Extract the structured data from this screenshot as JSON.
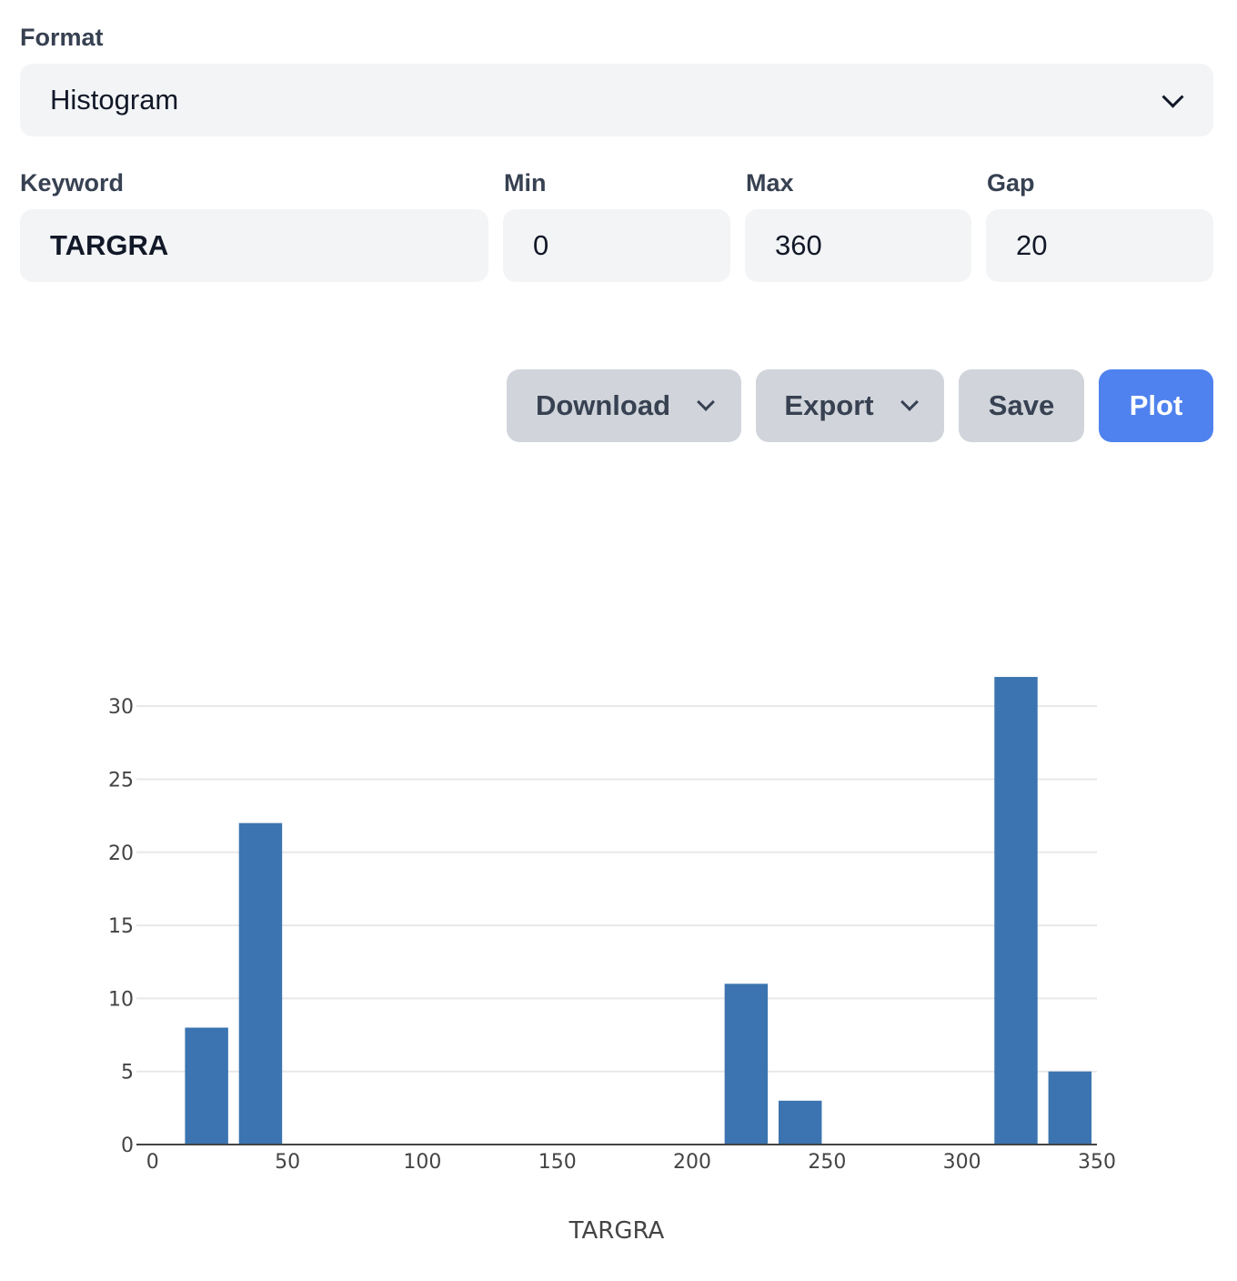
{
  "form": {
    "format_label": "Format",
    "format_value": "Histogram",
    "keyword_label": "Keyword",
    "keyword_value": "TARGRA",
    "min_label": "Min",
    "min_value": "0",
    "max_label": "Max",
    "max_value": "360",
    "gap_label": "Gap",
    "gap_value": "20"
  },
  "toolbar": {
    "download_label": "Download",
    "export_label": "Export",
    "save_label": "Save",
    "plot_label": "Plot"
  },
  "colors": {
    "accent": "#4f82ee",
    "bar": "#3b74b0"
  },
  "icons": {
    "dropdown": "chevron-down-icon"
  },
  "chart_data": {
    "type": "bar",
    "xlabel": "TARGRA",
    "ylabel": "",
    "xlim": [
      -6,
      350
    ],
    "ylim": [
      0,
      33
    ],
    "x_ticks": [
      0,
      50,
      100,
      150,
      200,
      250,
      300,
      350
    ],
    "y_ticks": [
      0,
      5,
      10,
      15,
      20,
      25,
      30
    ],
    "bins": [
      {
        "start": 12,
        "end": 28,
        "value": 8
      },
      {
        "start": 32,
        "end": 48,
        "value": 22
      },
      {
        "start": 212,
        "end": 228,
        "value": 11
      },
      {
        "start": 232,
        "end": 248,
        "value": 3
      },
      {
        "start": 312,
        "end": 328,
        "value": 32
      },
      {
        "start": 332,
        "end": 348,
        "value": 5
      }
    ],
    "grid": true
  }
}
